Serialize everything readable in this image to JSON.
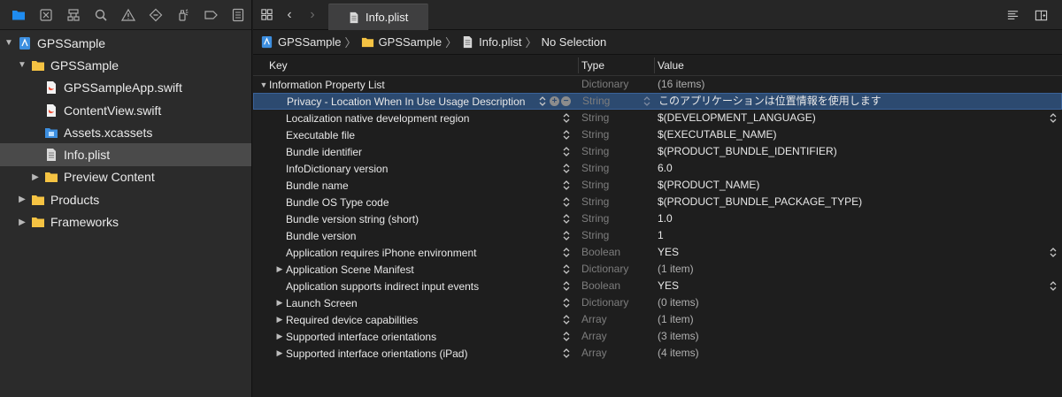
{
  "navigator": {
    "toolbar": [
      "folder-icon",
      "issue-x-icon",
      "hierarchy-icon",
      "search-icon",
      "warning-icon",
      "test-diamond-icon",
      "debug-spray-icon",
      "breakpoint-tag-icon",
      "report-list-icon"
    ],
    "tree": [
      {
        "label": "GPSSample",
        "kind": "project",
        "indent": 0,
        "expanded": true
      },
      {
        "label": "GPSSample",
        "kind": "folder",
        "indent": 1,
        "expanded": true
      },
      {
        "label": "GPSSampleApp.swift",
        "kind": "swift",
        "indent": 2
      },
      {
        "label": "ContentView.swift",
        "kind": "swift",
        "indent": 2
      },
      {
        "label": "Assets.xcassets",
        "kind": "assets",
        "indent": 2
      },
      {
        "label": "Info.plist",
        "kind": "plist",
        "indent": 2,
        "selected": true
      },
      {
        "label": "Preview Content",
        "kind": "folder",
        "indent": 2,
        "expanded": false
      },
      {
        "label": "Products",
        "kind": "folder",
        "indent": 1,
        "expanded": false
      },
      {
        "label": "Frameworks",
        "kind": "folder",
        "indent": 1,
        "expanded": false
      }
    ]
  },
  "tab": {
    "label": "Info.plist"
  },
  "jumpbar": {
    "project": "GPSSample",
    "group": "GPSSample",
    "file": "Info.plist",
    "selection": "No Selection"
  },
  "plist": {
    "headers": {
      "key": "Key",
      "type": "Type",
      "value": "Value"
    },
    "rows": [
      {
        "key": "Information Property List",
        "type": "Dictionary",
        "value": "(16 items)",
        "indent": 0,
        "disclosure": "open",
        "dimValue": true
      },
      {
        "key": "Privacy - Location When In Use Usage Description",
        "type": "String",
        "value": "このアプリケーションは位置情報を使用します",
        "indent": 1,
        "selected": true
      },
      {
        "key": "Localization native development region",
        "type": "String",
        "value": "$(DEVELOPMENT_LANGUAGE)",
        "indent": 1,
        "valueStepper": true
      },
      {
        "key": "Executable file",
        "type": "String",
        "value": "$(EXECUTABLE_NAME)",
        "indent": 1
      },
      {
        "key": "Bundle identifier",
        "type": "String",
        "value": "$(PRODUCT_BUNDLE_IDENTIFIER)",
        "indent": 1
      },
      {
        "key": "InfoDictionary version",
        "type": "String",
        "value": "6.0",
        "indent": 1
      },
      {
        "key": "Bundle name",
        "type": "String",
        "value": "$(PRODUCT_NAME)",
        "indent": 1
      },
      {
        "key": "Bundle OS Type code",
        "type": "String",
        "value": "$(PRODUCT_BUNDLE_PACKAGE_TYPE)",
        "indent": 1
      },
      {
        "key": "Bundle version string (short)",
        "type": "String",
        "value": "1.0",
        "indent": 1
      },
      {
        "key": "Bundle version",
        "type": "String",
        "value": "1",
        "indent": 1
      },
      {
        "key": "Application requires iPhone environment",
        "type": "Boolean",
        "value": "YES",
        "indent": 1,
        "valueStepper": true
      },
      {
        "key": "Application Scene Manifest",
        "type": "Dictionary",
        "value": "(1 item)",
        "indent": 1,
        "disclosure": "closed",
        "dimValue": true
      },
      {
        "key": "Application supports indirect input events",
        "type": "Boolean",
        "value": "YES",
        "indent": 1,
        "valueStepper": true
      },
      {
        "key": "Launch Screen",
        "type": "Dictionary",
        "value": "(0 items)",
        "indent": 1,
        "disclosure": "closed",
        "dimValue": true
      },
      {
        "key": "Required device capabilities",
        "type": "Array",
        "value": "(1 item)",
        "indent": 1,
        "disclosure": "closed",
        "dimValue": true
      },
      {
        "key": "Supported interface orientations",
        "type": "Array",
        "value": "(3 items)",
        "indent": 1,
        "disclosure": "closed",
        "dimValue": true
      },
      {
        "key": "Supported interface orientations (iPad)",
        "type": "Array",
        "value": "(4 items)",
        "indent": 1,
        "disclosure": "closed",
        "dimValue": true
      }
    ]
  },
  "colors": {
    "selection": "#2c4a70",
    "folder": "#f5c343",
    "accent": "#1f8cf0"
  }
}
